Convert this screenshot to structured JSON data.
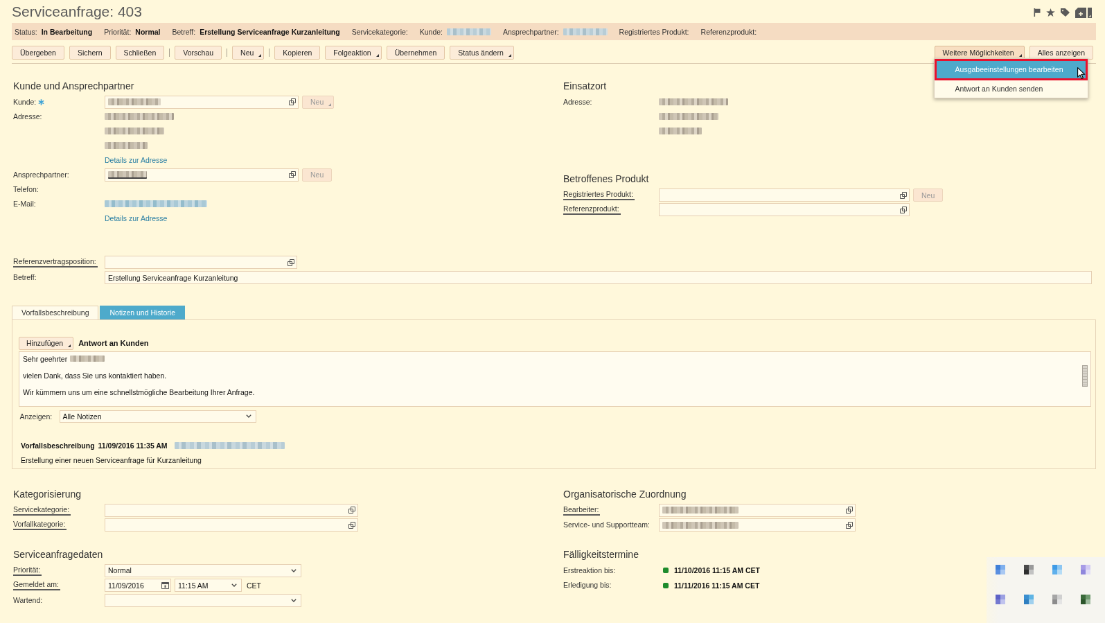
{
  "window": {
    "title": "Serviceanfrage: 403"
  },
  "status_bar": [
    {
      "label": "Status:",
      "value": "In Bearbeitung",
      "redacted": false
    },
    {
      "label": "Priorität:",
      "value": "Normal",
      "redacted": false
    },
    {
      "label": "Betreff:",
      "value": "Erstellung Serviceanfrage Kurzanleitung",
      "redacted": false
    },
    {
      "label": "Servicekategorie:",
      "redacted": false
    },
    {
      "label": "Kunde:",
      "redacted": true
    },
    {
      "label": "Ansprechpartner:",
      "redacted": true
    },
    {
      "label": "Registriertes Produkt:",
      "redacted": false
    },
    {
      "label": "Referenzprodukt:",
      "redacted": false
    }
  ],
  "toolbar": {
    "groups": [
      [
        {
          "label": "Übergeben",
          "menu": false
        },
        {
          "label": "Sichern",
          "menu": false
        },
        {
          "label": "Schließen",
          "menu": false
        }
      ],
      [
        {
          "label": "Vorschau",
          "menu": false
        }
      ],
      [
        {
          "label": "Neu",
          "menu": true
        }
      ],
      [
        {
          "label": "Kopieren",
          "menu": false
        },
        {
          "label": "Folgeaktion",
          "menu": true
        },
        {
          "label": "Übernehmen",
          "menu": false
        },
        {
          "label": "Status ändern",
          "menu": true
        }
      ]
    ],
    "right": [
      {
        "label": "Weitere Möglichkeiten",
        "menu": true,
        "expanded": true,
        "menu_items": [
          {
            "label": "Ausgabeeinstellungen bearbeiten",
            "selected": true,
            "marked": true
          },
          {
            "label": "Antwort an Kunden senden",
            "selected": false,
            "marked": false
          }
        ]
      },
      {
        "label": "Alles anzeigen",
        "menu": false,
        "expanded": false
      }
    ]
  },
  "upper": {
    "left": [
      {
        "title": "Kunde und Ansprechpartner",
        "rows": [
          {
            "kind": "lookup",
            "label": "Kunde:",
            "required": true,
            "label_underlined": false,
            "value_redacted": true,
            "value_underlined": false,
            "new_button": {
              "label": "Neu",
              "disabled": true,
              "menu": true
            }
          },
          {
            "kind": "lines",
            "label": "Adresse:",
            "required": false,
            "label_underlined": false,
            "lines": [
              {
                "redacted": true,
                "link": false
              },
              {
                "redacted": true,
                "link": false
              },
              {
                "redacted": true,
                "link": false
              }
            ]
          },
          {
            "kind": "link",
            "link": "Details zur Adresse"
          },
          {
            "kind": "lookup",
            "label": "Ansprechpartner:",
            "required": false,
            "label_underlined": false,
            "value_redacted": true,
            "value_underlined": true,
            "new_button": {
              "label": "Neu",
              "disabled": true,
              "menu": false
            }
          },
          {
            "kind": "label",
            "label": "Telefon:",
            "required": false,
            "label_underlined": false
          },
          {
            "kind": "lines",
            "label": "E-Mail:",
            "required": false,
            "label_underlined": false,
            "lines": [
              {
                "redacted": true,
                "link": true
              }
            ]
          },
          {
            "kind": "link",
            "link": "Details zur Adresse"
          }
        ]
      }
    ],
    "right": [
      {
        "title": "Einsatzort",
        "rows": [
          {
            "kind": "lines",
            "label": "Adresse:",
            "required": false,
            "label_underlined": false,
            "lines": [
              {
                "redacted": true,
                "link": false
              },
              {
                "redacted": true,
                "link": false
              },
              {
                "redacted": true,
                "link": false
              }
            ]
          }
        ]
      },
      {
        "title": "Betroffenes Produkt",
        "rows": [
          {
            "kind": "lookup",
            "label": "Registriertes Produkt:",
            "required": false,
            "label_underlined": true,
            "value_redacted": false,
            "new_button": {
              "label": "Neu",
              "disabled": true,
              "menu": false
            }
          },
          {
            "kind": "lookup",
            "label": "Referenzprodukt:",
            "required": false,
            "label_underlined": true,
            "value_redacted": false
          }
        ]
      }
    ]
  },
  "reference_rows": [
    {
      "kind": "lookup",
      "label": "Referenzvertragsposition:",
      "required": false,
      "label_underlined": true,
      "value_redacted": false
    },
    {
      "kind": "input",
      "label": "Betreff:",
      "required": false,
      "label_underlined": false,
      "value": "Erstellung Serviceanfrage Kurzanleitung"
    }
  ],
  "tabs": [
    {
      "label": "Vorfallsbeschreibung",
      "selected": false
    },
    {
      "label": "Notizen und Historie",
      "selected": true
    }
  ],
  "notes_panel": {
    "add_button": {
      "label": "Hinzufügen",
      "menu": true
    },
    "note_type": "Antwort an Kunden",
    "editor_lines": [
      {
        "text": "Sehr geehrter",
        "redacted_suffix": true
      },
      {
        "text": "vielen Dank, dass Sie uns kontaktiert haben.",
        "redacted_suffix": false
      },
      {
        "text": "Wir kümmern uns um eine schnellstmögliche Bearbeitung Ihrer Anfrage.",
        "redacted_suffix": false
      }
    ],
    "filter": {
      "label": "Anzeigen:",
      "value": "Alle Notizen"
    },
    "notes": [
      {
        "type": "Vorfallsbeschreibung",
        "timestamp": "11/09/2016 11:35 AM",
        "author_redacted": true,
        "text": "Erstellung einer neuen Serviceanfrage für Kurzanleitung"
      }
    ]
  },
  "lower": {
    "left": [
      {
        "title": "Kategorisierung",
        "rows": [
          {
            "kind": "lookup",
            "label": "Servicekategorie:",
            "required": false,
            "label_underlined": true,
            "value_redacted": false
          },
          {
            "kind": "lookup",
            "label": "Vorfallkategorie:",
            "required": false,
            "label_underlined": true,
            "value_redacted": false
          }
        ]
      },
      {
        "title": "Serviceanfragedaten",
        "rows": [
          {
            "kind": "select",
            "label": "Priorität:",
            "required": false,
            "label_underlined": true,
            "value": "Normal"
          },
          {
            "kind": "datetime",
            "label": "Gemeldet am:",
            "required": false,
            "label_underlined": true,
            "date": "11/09/2016",
            "time": "11:15 AM",
            "timezone": "CET"
          },
          {
            "kind": "select",
            "label": "Wartend:",
            "required": false,
            "label_underlined": false
          }
        ]
      }
    ],
    "right": [
      {
        "title": "Organisatorische Zuordnung",
        "rows": [
          {
            "kind": "lookup",
            "label": "Bearbeiter:",
            "required": false,
            "label_underlined": true,
            "value_redacted": true,
            "value_underlined": false
          },
          {
            "kind": "lookup",
            "label": "Service- und Supportteam:",
            "required": false,
            "label_underlined": false,
            "value_redacted": true,
            "value_underlined": false
          }
        ]
      },
      {
        "title": "Fälligkeitstermine",
        "rows": [
          {
            "kind": "status",
            "label": "Erstreaktion bis:",
            "required": false,
            "label_underlined": false,
            "color": "#1e8c2c",
            "value": "11/10/2016 11:15 AM CET"
          },
          {
            "kind": "status",
            "label": "Erledigung bis:",
            "required": false,
            "label_underlined": false,
            "color": "#1e8c2c",
            "value": "11/11/2016 11:15 AM CET"
          }
        ]
      }
    ]
  }
}
